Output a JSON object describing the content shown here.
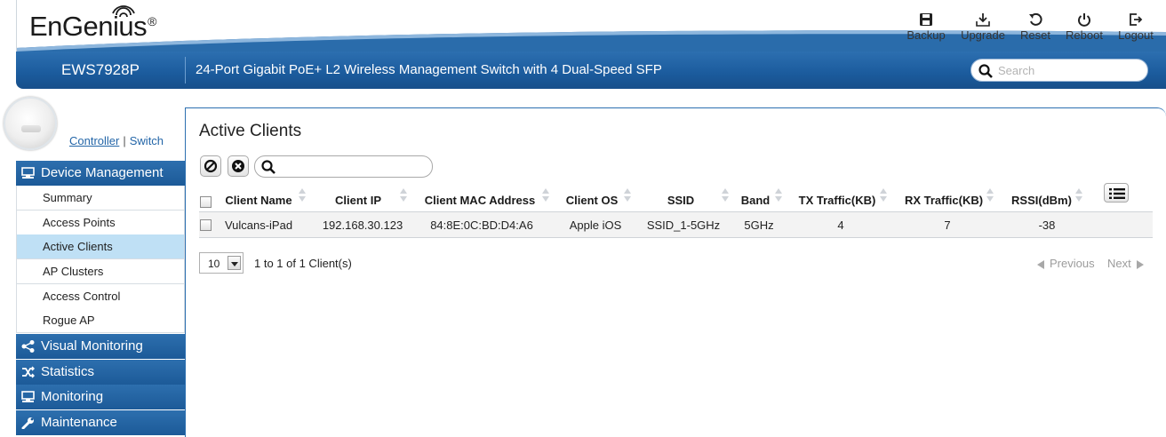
{
  "brand": {
    "logo_text": "EnGenius",
    "registered": "®",
    "accent": "#1f5f9f"
  },
  "toolbar": [
    {
      "label": "Backup",
      "icon": "save-icon"
    },
    {
      "label": "Upgrade",
      "icon": "upgrade-icon"
    },
    {
      "label": "Reset",
      "icon": "reset-icon"
    },
    {
      "label": "Reboot",
      "icon": "power-icon"
    },
    {
      "label": "Logout",
      "icon": "logout-icon"
    }
  ],
  "bar": {
    "model": "EWS7928P",
    "product": "24-Port Gigabit PoE+ L2 Wireless Management Switch with 4 Dual-Speed SFP",
    "search_placeholder": "Search"
  },
  "sidebar": {
    "controller": "Controller",
    "separator": "|",
    "switch": "Switch",
    "sections": [
      {
        "label": "Device Management",
        "icon": "device-icon"
      },
      {
        "label": "Visual Monitoring",
        "icon": "share-icon"
      },
      {
        "label": "Statistics",
        "icon": "shuffle-icon"
      },
      {
        "label": "Monitoring",
        "icon": "monitor-icon"
      },
      {
        "label": "Maintenance",
        "icon": "wrench-icon"
      }
    ],
    "items": [
      "Summary",
      "Access Points",
      "Active Clients",
      "AP Clusters",
      "Access Control",
      "Rogue AP"
    ],
    "active_item": "Active Clients"
  },
  "main": {
    "title": "Active Clients",
    "columns": [
      "Client Name",
      "Client IP",
      "Client MAC Address",
      "Client OS",
      "SSID",
      "Band",
      "TX Traffic(KB)",
      "RX Traffic(KB)",
      "RSSI(dBm)"
    ],
    "rows": [
      [
        "Vulcans-iPad",
        "192.168.30.123",
        "84:8E:0C:BD:D4:A6",
        "Apple iOS",
        "SSID_1-5GHz",
        "5GHz",
        "4",
        "7",
        "-38"
      ]
    ],
    "page_size": "10",
    "range_info": "1 to 1 of 1 Client(s)",
    "prev_label": "Previous",
    "next_label": "Next"
  }
}
